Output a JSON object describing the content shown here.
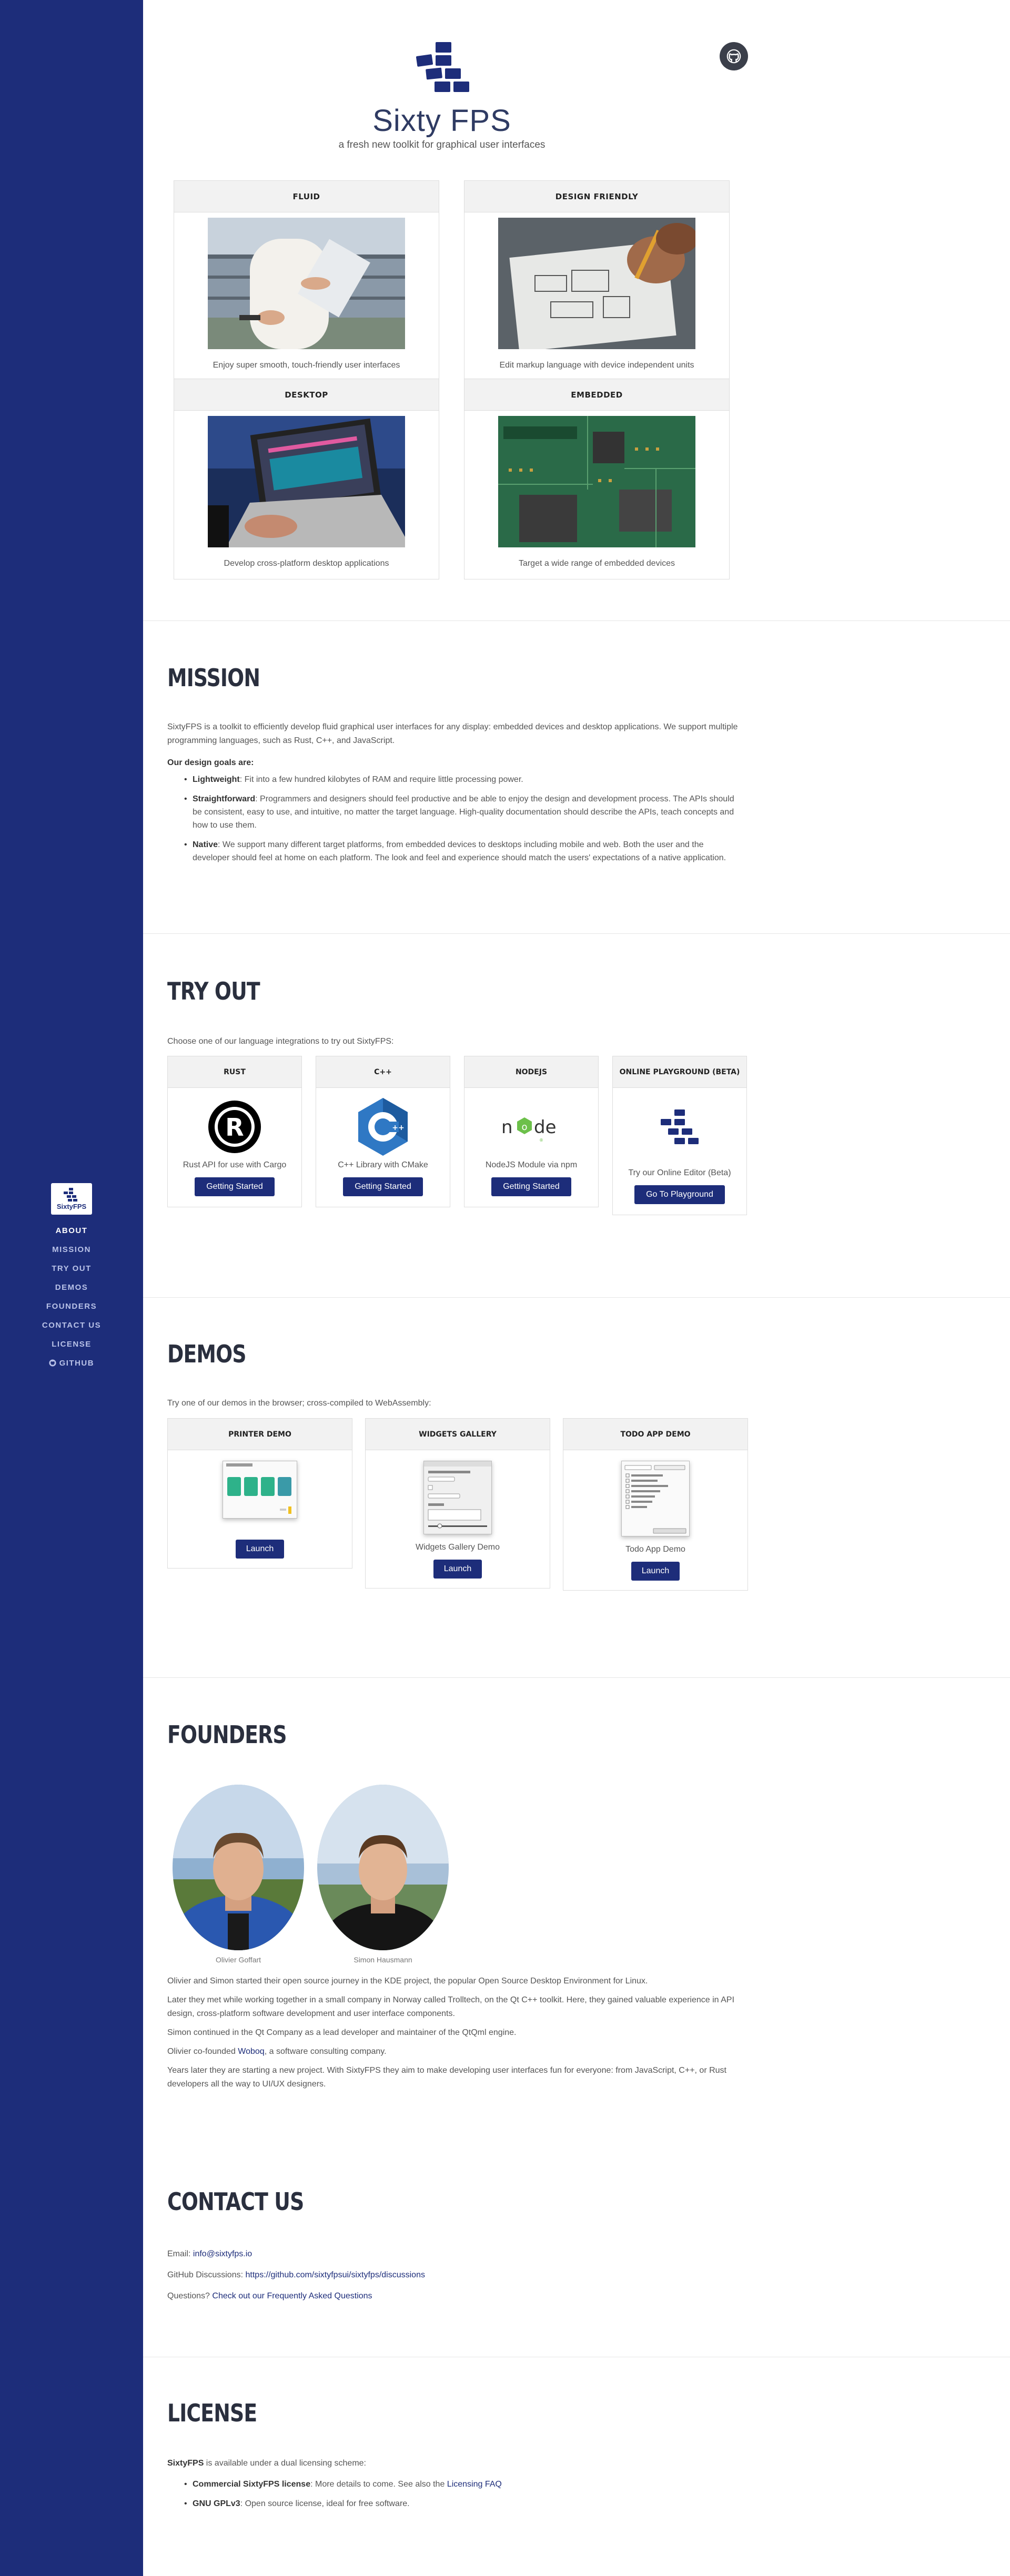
{
  "sidebar": {
    "logo_text": "SixtyFPS",
    "items": [
      {
        "label": "About"
      },
      {
        "label": "Mission"
      },
      {
        "label": "Try Out"
      },
      {
        "label": "Demos"
      },
      {
        "label": "Founders"
      },
      {
        "label": "Contact Us"
      },
      {
        "label": "License"
      },
      {
        "label": "GitHub"
      }
    ]
  },
  "header": {
    "title": "Sixty FPS",
    "tagline": "a fresh new toolkit for graphical user interfaces"
  },
  "features": [
    {
      "title": "FLUID",
      "caption": "Enjoy super smooth, touch-friendly user interfaces"
    },
    {
      "title": "DESIGN FRIENDLY",
      "caption": "Edit markup language with device independent units"
    },
    {
      "title": "DESKTOP",
      "caption": "Develop cross-platform desktop applications"
    },
    {
      "title": "EMBEDDED",
      "caption": "Target a wide range of embedded devices"
    }
  ],
  "mission": {
    "title": "MISSION",
    "intro": "SixtyFPS is a toolkit to efficiently develop fluid graphical user interfaces for any display: embedded devices and desktop applications. We support multiple programming languages, such as Rust, C++, and JavaScript.",
    "goals_heading": "Our design goals are:",
    "goals": [
      {
        "name": "Lightweight",
        "text": ": Fit into a few hundred kilobytes of RAM and require little processing power."
      },
      {
        "name": "Straightforward",
        "text": ": Programmers and designers should feel productive and be able to enjoy the design and development process. The APIs should be consistent, easy to use, and intuitive, no matter the target language. High-quality documentation should describe the APIs, teach concepts and how to use them."
      },
      {
        "name": "Native",
        "text": ": We support many different target platforms, from embedded devices to desktops including mobile and web. Both the user and the developer should feel at home on each platform. The look and feel and experience should match the users' expectations of a native application."
      }
    ]
  },
  "tryout": {
    "title": "TRY OUT",
    "intro": "Choose one of our language integrations to try out SixtyFPS:",
    "cards": [
      {
        "title": "RUST",
        "caption": "Rust API for use with Cargo",
        "button": "Getting Started"
      },
      {
        "title": "C++",
        "caption": "C++ Library with CMake",
        "button": "Getting Started"
      },
      {
        "title": "NODEJS",
        "caption": "NodeJS Module via npm",
        "button": "Getting Started"
      },
      {
        "title": "ONLINE PLAYGROUND (BETA)",
        "caption": "Try our Online Editor (Beta)",
        "button": "Go To Playground"
      }
    ]
  },
  "demos": {
    "title": "DEMOS",
    "intro": "Try one of our demos in the browser; cross-compiled to WebAssembly:",
    "cards": [
      {
        "title": "PRINTER DEMO",
        "caption": "",
        "button": "Launch"
      },
      {
        "title": "WIDGETS GALLERY",
        "caption": "Widgets Gallery Demo",
        "button": "Launch"
      },
      {
        "title": "TODO APP DEMO",
        "caption": "Todo App Demo",
        "button": "Launch"
      }
    ]
  },
  "founders": {
    "title": "FOUNDERS",
    "people": [
      {
        "name": "Olivier Goffart"
      },
      {
        "name": "Simon Hausmann"
      }
    ],
    "p1": "Olivier and Simon started their open source journey in the KDE project, the popular Open Source Desktop Environment for Linux.",
    "p2": "Later they met while working together in a small company in Norway called Trolltech, on the Qt C++ toolkit. Here, they gained valuable experience in API design, cross-platform software development and user interface components.",
    "p3": "Simon continued in the Qt Company as a lead developer and maintainer of the QtQml engine.",
    "p4_before": "Olivier co-founded ",
    "p4_link": "Woboq",
    "p4_after": ", a software consulting company.",
    "p5": "Years later they are starting a new project. With SixtyFPS they aim to make developing user interfaces fun for everyone: from JavaScript, C++, or Rust developers all the way to UI/UX designers."
  },
  "contact": {
    "title": "CONTACT US",
    "email_label": "Email: ",
    "email": "info@sixtyfps.io",
    "github_label": "GitHub Discussions: ",
    "github_link": "https://github.com/sixtyfpsui/sixtyfps/discussions",
    "questions_label": "Questions? ",
    "faq_link": "Check out our Frequently Asked Questions"
  },
  "license": {
    "title": "LICENSE",
    "intro_bold": "SixtyFPS",
    "intro_rest": " is available under a dual licensing scheme:",
    "items": [
      {
        "name": "Commercial SixtyFPS license",
        "text": ": More details to come. See also the ",
        "link": "Licensing FAQ"
      },
      {
        "name": "GNU GPLv3",
        "text": ": Open source license, ideal for free software.",
        "link": ""
      }
    ]
  },
  "colors": {
    "brand": "#1d2d7a",
    "sidebar": "#1d2d7a"
  }
}
